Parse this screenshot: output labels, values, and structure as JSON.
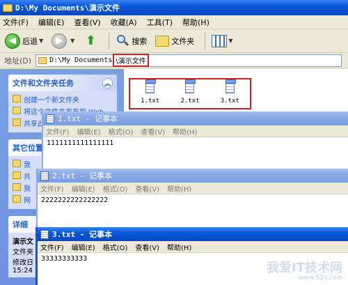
{
  "explorer": {
    "title": "D:\\My Documents\\演示文件",
    "menu": [
      "文件(F)",
      "编辑(E)",
      "查看(V)",
      "收藏(A)",
      "工具(T)",
      "帮助(H)"
    ],
    "toolbar": {
      "back": "后退",
      "search": "搜索",
      "folders": "文件夹"
    },
    "address": {
      "label": "地址(D)",
      "path_prefix": "D:\\My Documents",
      "path_highlight": "\\演示文件"
    },
    "left_panels": {
      "tasks": {
        "title": "文件和文件夹任务",
        "items": [
          "创建一个新文件夹",
          "将这个文件夹发布到 Web",
          "共享此文件夹"
        ]
      },
      "other": {
        "title": "其它位置",
        "items": [
          "我",
          "共",
          "我",
          "网"
        ]
      },
      "details": {
        "title": "详细",
        "lines": [
          "演示文",
          "文件夹",
          "修改日",
          "15:24"
        ]
      }
    },
    "files": [
      "1.txt",
      "2.txt",
      "3.txt"
    ]
  },
  "notepads": [
    {
      "title": "1.txt - 记事本",
      "menu": [
        "文件(F)",
        "编辑(E)",
        "格式(O)",
        "查看(V)",
        "帮助(H)"
      ],
      "content": "1111111111111111"
    },
    {
      "title": "2.txt - 记事本",
      "menu": [
        "文件(F)",
        "编辑(E)",
        "格式(O)",
        "查看(V)",
        "帮助(H)"
      ],
      "content": "2222222222222222"
    },
    {
      "title": "3.txt - 记事本",
      "menu": [
        "文件(F)",
        "编辑(E)",
        "格式(O)",
        "查看(V)",
        "帮助(H)"
      ],
      "content": "33333333333"
    }
  ],
  "watermark": {
    "main": "我爱IT技术网",
    "sub": "www.52ij.com"
  }
}
